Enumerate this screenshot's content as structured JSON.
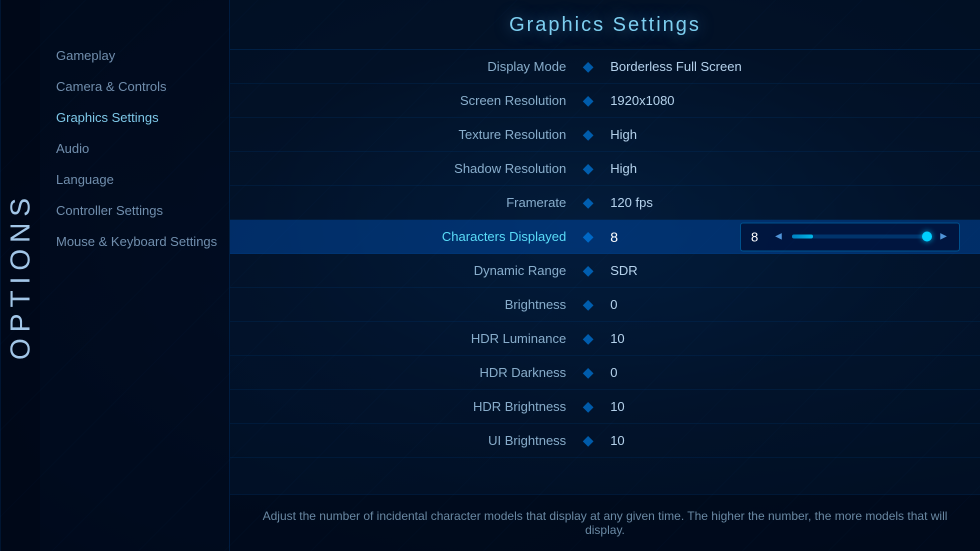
{
  "app": {
    "title": "Options"
  },
  "page": {
    "title": "Graphics Settings"
  },
  "sidebar": {
    "items": [
      {
        "id": "gameplay",
        "label": "Gameplay"
      },
      {
        "id": "camera-controls",
        "label": "Camera & Controls"
      },
      {
        "id": "graphics-settings",
        "label": "Graphics Settings"
      },
      {
        "id": "audio",
        "label": "Audio"
      },
      {
        "id": "language",
        "label": "Language"
      },
      {
        "id": "controller-settings",
        "label": "Controller Settings"
      },
      {
        "id": "mouse-keyboard",
        "label": "Mouse & Keyboard Settings"
      }
    ]
  },
  "settings": {
    "rows": [
      {
        "label": "Display Mode",
        "value": "Borderless Full Screen",
        "highlighted": false
      },
      {
        "label": "Screen Resolution",
        "value": "1920x1080",
        "highlighted": false
      },
      {
        "label": "Texture Resolution",
        "value": "High",
        "highlighted": false
      },
      {
        "label": "Shadow Resolution",
        "value": "High",
        "highlighted": false
      },
      {
        "label": "Framerate",
        "value": "120 fps",
        "highlighted": false
      },
      {
        "label": "Characters Displayed",
        "value": "8",
        "highlighted": true
      },
      {
        "label": "Dynamic Range",
        "value": "SDR",
        "highlighted": false
      },
      {
        "label": "Brightness",
        "value": "0",
        "highlighted": false
      },
      {
        "label": "HDR Luminance",
        "value": "10",
        "highlighted": false
      },
      {
        "label": "HDR Darkness",
        "value": "0",
        "highlighted": false
      },
      {
        "label": "HDR Brightness",
        "value": "10",
        "highlighted": false
      },
      {
        "label": "UI Brightness",
        "value": "10",
        "highlighted": false
      }
    ],
    "slider": {
      "value": "8",
      "fill_percent": 15
    }
  },
  "footer": {
    "text": "Adjust the number of incidental character models that display at any given time. The higher the number, the more models that will display."
  },
  "divider_char": "◆",
  "arrow_left": "◄",
  "arrow_right": "►"
}
